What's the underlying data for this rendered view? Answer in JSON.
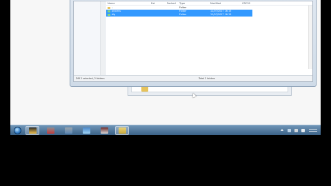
{
  "explorer": {
    "columns": [
      "Name",
      "Ext",
      "Packed",
      "Type",
      "Modified",
      "CRC32"
    ],
    "rows": [
      {
        "name": "..",
        "type": "Folder",
        "modified": "",
        "selected": false,
        "icon_color": "#e7c35b"
      },
      {
        "name": "process",
        "type": "Folder",
        "modified": "11/07/2017 16:15",
        "selected": true,
        "icon_color": "#8bd37a"
      },
      {
        "name": "dlg",
        "type": "Folder",
        "modified": "11/07/2017 16:15",
        "selected": true,
        "icon_color": "#8bd37a"
      }
    ],
    "status_left": "DIR 2 selected, 2 folders",
    "status_right": "Total 2 folders"
  },
  "taskbar": {
    "apps": [
      {
        "name": "folder-icon",
        "color": "#2b2b2b",
        "accent": "#f2c14e",
        "active": true
      },
      {
        "name": "settings-icon",
        "color": "#8a8f95",
        "accent": "#c23b3b",
        "active": false
      },
      {
        "name": "tools-icon",
        "color": "#9aa3ab",
        "accent": "#5d88b5",
        "active": false
      },
      {
        "name": "globe-icon",
        "color": "#4a87c9",
        "accent": "#9ed3f5",
        "active": false
      },
      {
        "name": "archive-icon",
        "color": "#6d2d2d",
        "accent": "#d8d8d8",
        "active": false
      },
      {
        "name": "explorer-icon",
        "color": "#e8d27a",
        "accent": "#c9a93c",
        "active": true
      }
    ],
    "tray_icons": [
      "arrow-up-icon",
      "network-icon",
      "flag-icon",
      "speaker-icon"
    ]
  },
  "colors": {
    "selection": "#3399ff",
    "taskbar_top": "#6f95b7",
    "taskbar_bottom": "#3c6388"
  }
}
